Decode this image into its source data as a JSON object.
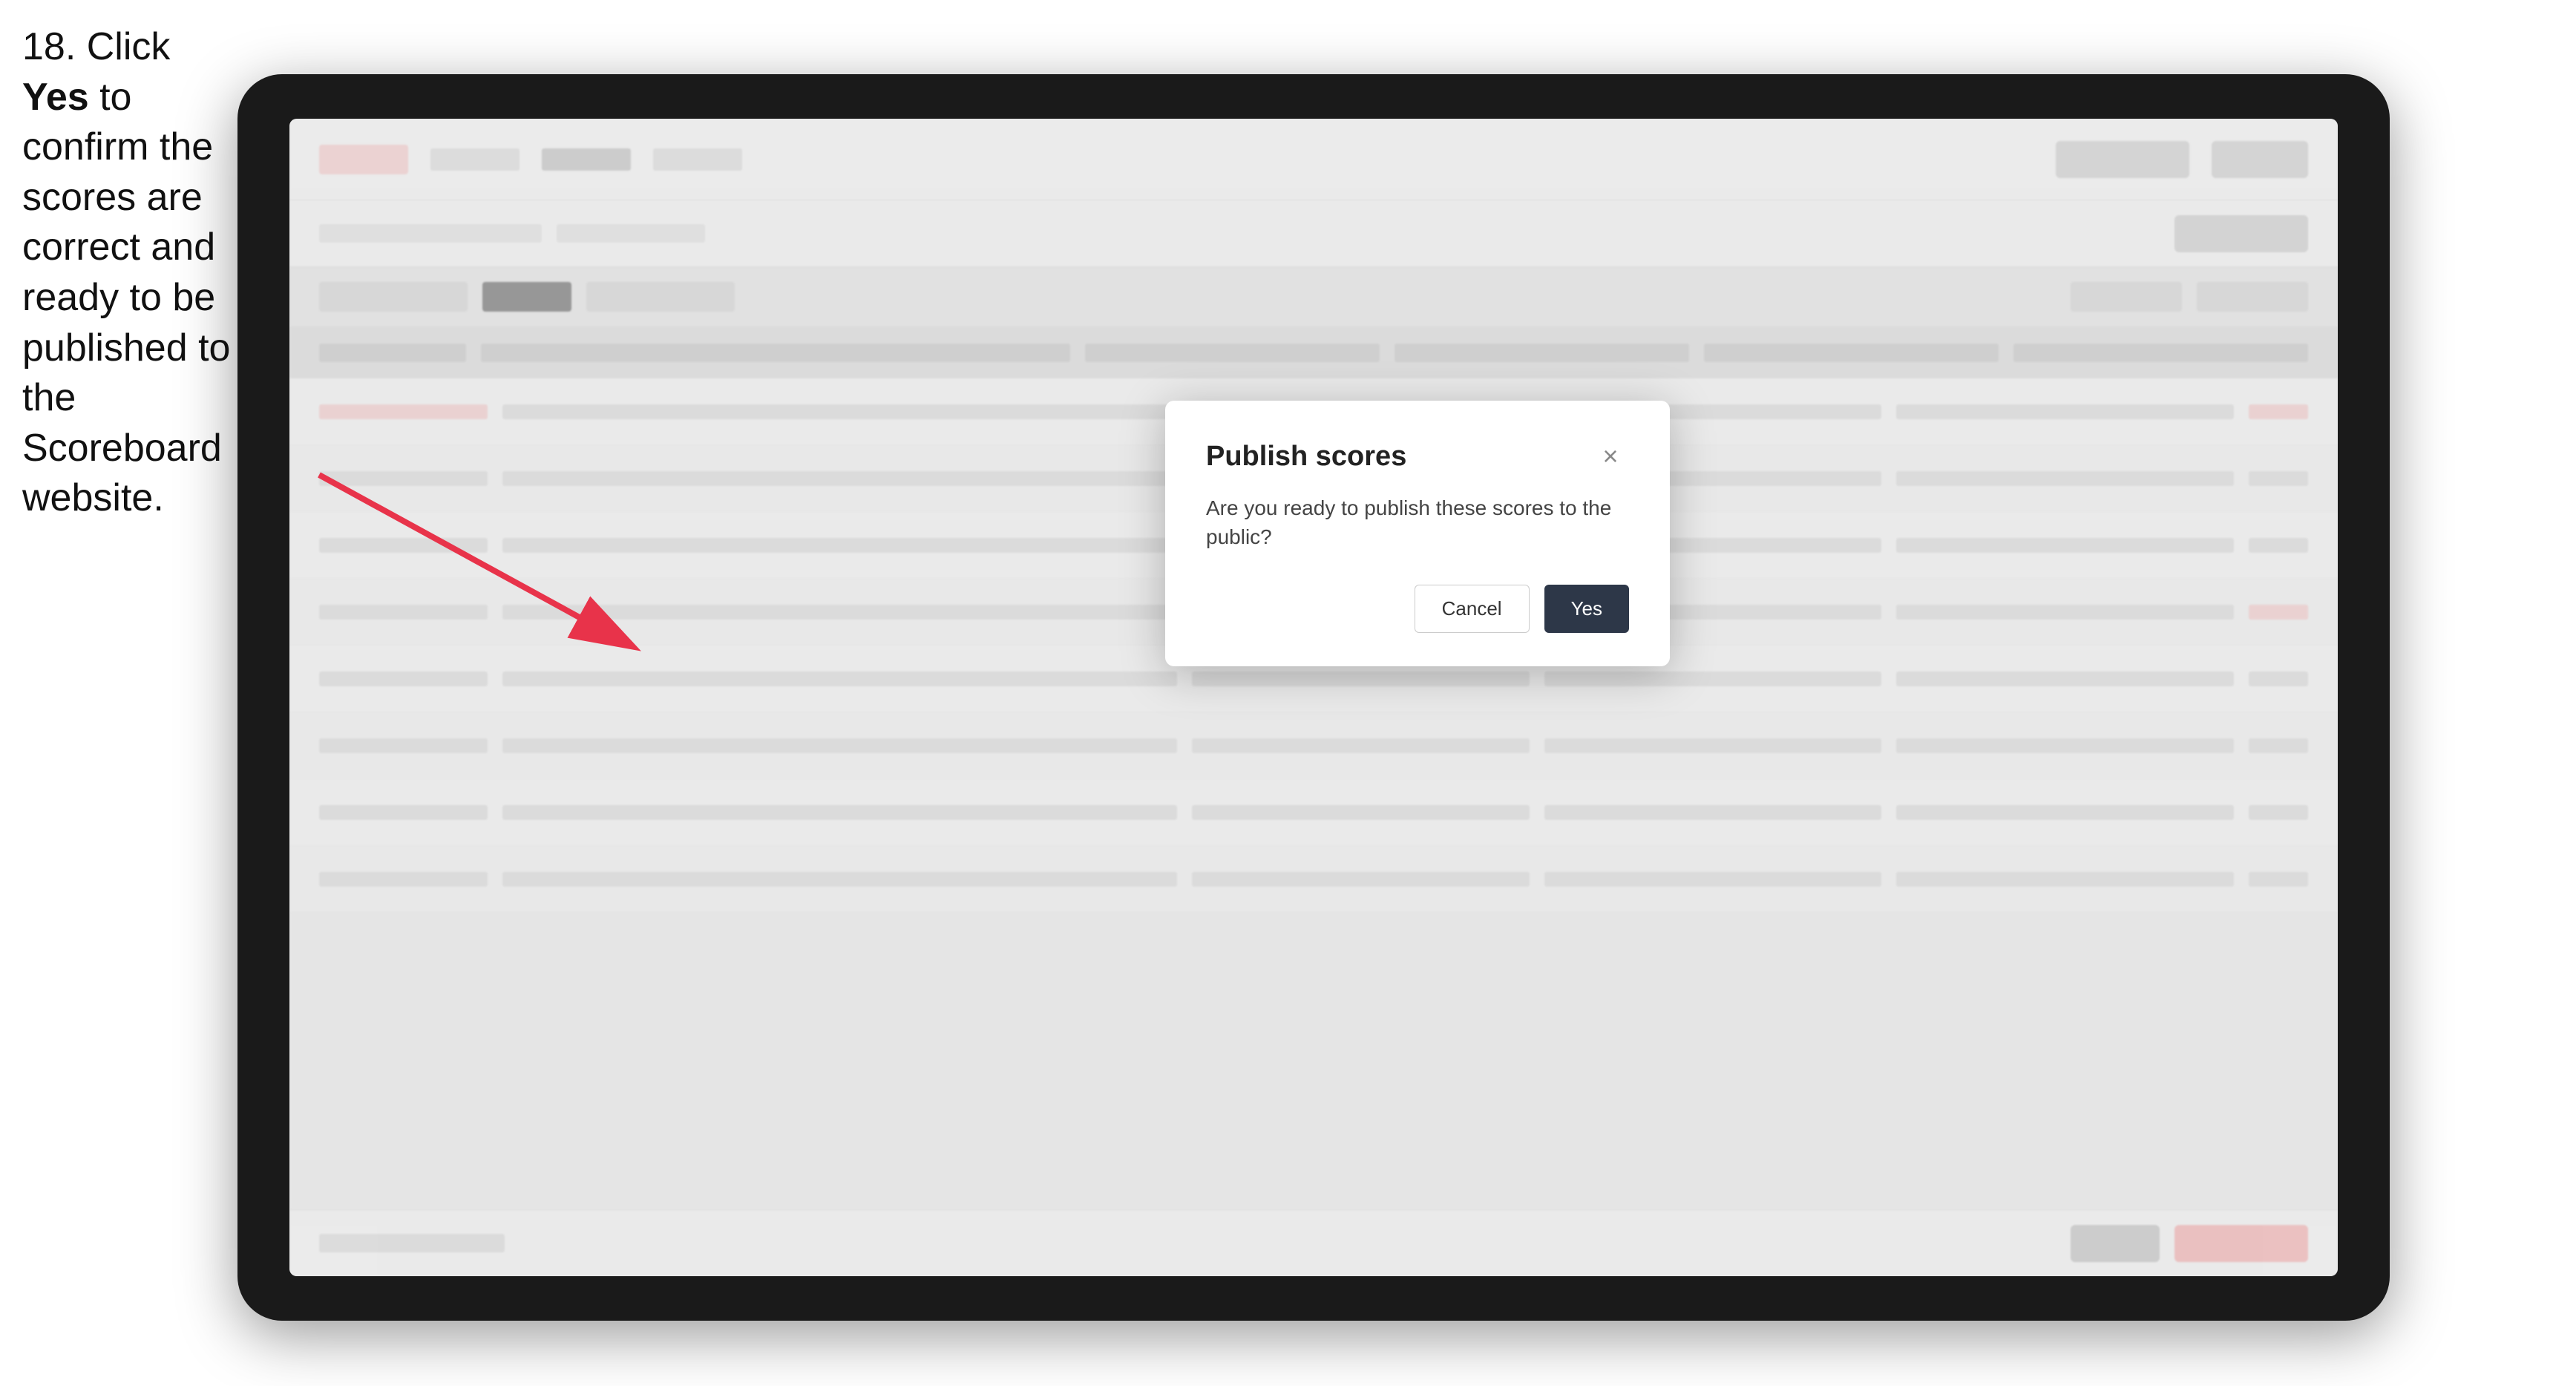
{
  "instruction": {
    "step_number": "18.",
    "text_part1": " Click ",
    "bold_word": "Yes",
    "text_part2": " to confirm the scores are correct and ready to be published to the Scoreboard website."
  },
  "dialog": {
    "title": "Publish scores",
    "message": "Are you ready to publish these scores to the public?",
    "cancel_label": "Cancel",
    "yes_label": "Yes",
    "close_icon": "×"
  },
  "app": {
    "table_rows": [
      {
        "id": "row-1"
      },
      {
        "id": "row-2"
      },
      {
        "id": "row-3"
      },
      {
        "id": "row-4"
      },
      {
        "id": "row-5"
      },
      {
        "id": "row-6"
      },
      {
        "id": "row-7"
      },
      {
        "id": "row-8"
      }
    ]
  }
}
